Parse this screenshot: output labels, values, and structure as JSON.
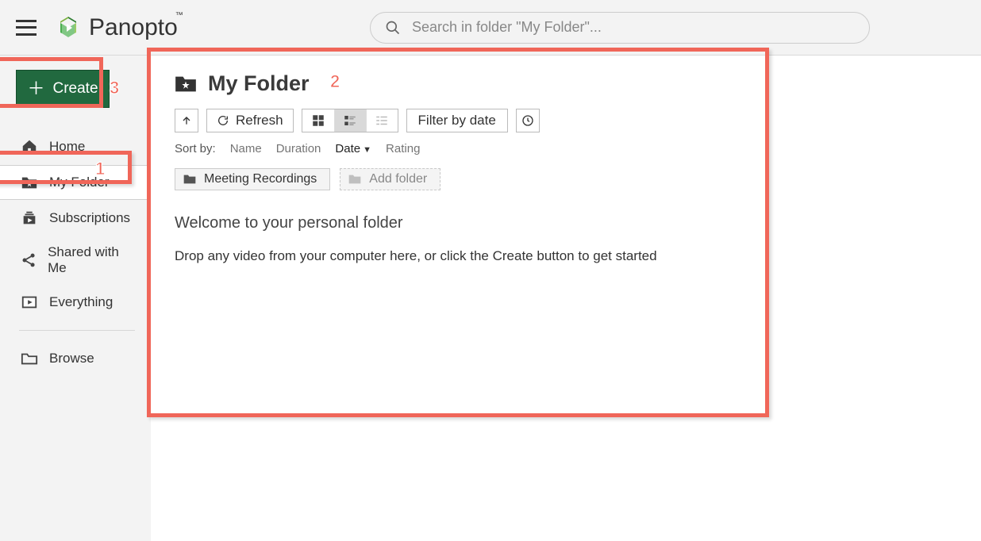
{
  "brand": {
    "name": "Panopto"
  },
  "search": {
    "placeholder": "Search in folder \"My Folder\"..."
  },
  "create": {
    "label": "Create"
  },
  "nav": {
    "home": "Home",
    "my_folder": "My Folder",
    "subscriptions": "Subscriptions",
    "shared": "Shared with Me",
    "everything": "Everything",
    "browse": "Browse"
  },
  "folder": {
    "title": "My Folder"
  },
  "toolbar": {
    "refresh": "Refresh",
    "filter": "Filter by date"
  },
  "sort": {
    "label": "Sort by:",
    "name": "Name",
    "duration": "Duration",
    "date": "Date",
    "rating": "Rating"
  },
  "subfolders": {
    "meeting_recordings": "Meeting Recordings",
    "add_folder": "Add folder"
  },
  "welcome": {
    "title": "Welcome to your personal folder",
    "sub": "Drop any video from your computer here, or click the Create button to get started"
  },
  "annotations": {
    "one": "1",
    "two": "2",
    "three": "3"
  }
}
